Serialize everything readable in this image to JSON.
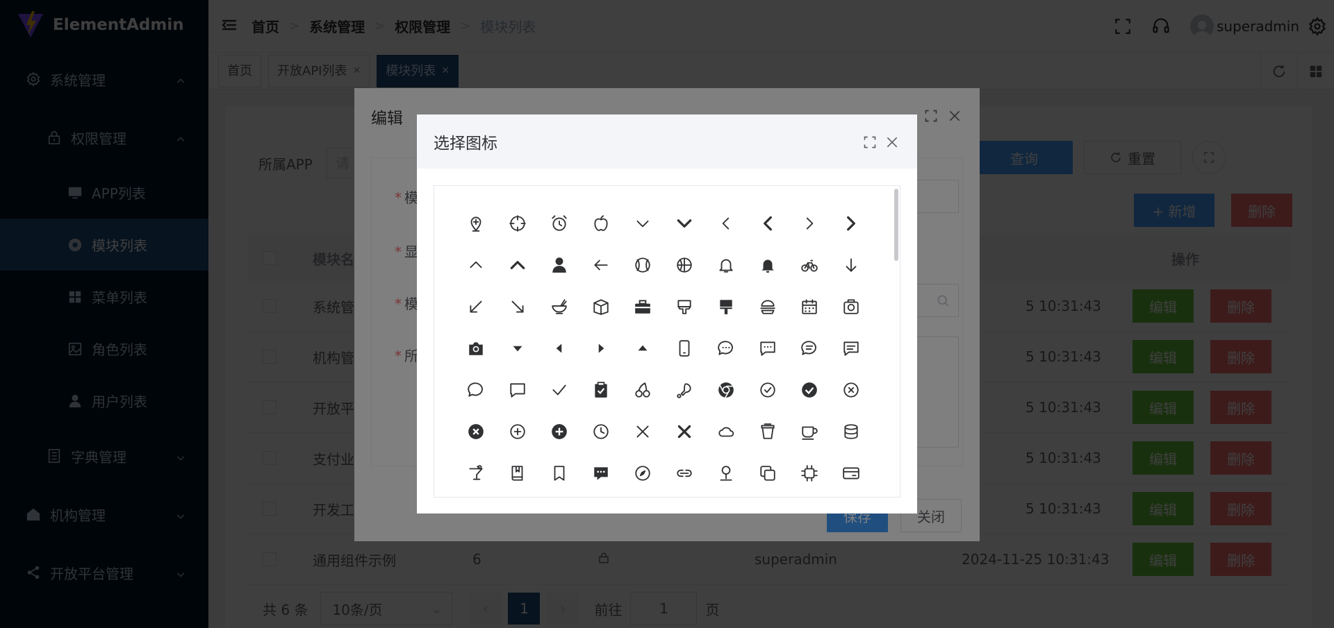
{
  "app": {
    "name": "ElementAdmin"
  },
  "sidebar": {
    "items": [
      {
        "label": "系统管理",
        "icon": "gear-icon",
        "level": 1,
        "expanded": true
      },
      {
        "label": "权限管理",
        "icon": "lock-icon",
        "level": 2,
        "expanded": true
      },
      {
        "label": "APP列表",
        "icon": "monitor-icon",
        "level": 3
      },
      {
        "label": "模块列表",
        "icon": "chrome-icon",
        "level": 3,
        "active": true
      },
      {
        "label": "菜单列表",
        "icon": "grid-icon",
        "level": 3
      },
      {
        "label": "角色列表",
        "icon": "picture-icon",
        "level": 3
      },
      {
        "label": "用户列表",
        "icon": "user-icon",
        "level": 3
      },
      {
        "label": "字典管理",
        "icon": "tickets-icon",
        "level": 2
      },
      {
        "label": "机构管理",
        "icon": "house-icon",
        "level": 1
      },
      {
        "label": "开放平台管理",
        "icon": "share-icon",
        "level": 1
      }
    ]
  },
  "header": {
    "breadcrumb": [
      "首页",
      "系统管理",
      "权限管理",
      "模块列表"
    ],
    "username": "superadmin"
  },
  "tags": [
    {
      "label": "首页",
      "closable": false,
      "active": false
    },
    {
      "label": "开放API列表",
      "closable": true,
      "active": false
    },
    {
      "label": "模块列表",
      "closable": true,
      "active": true
    }
  ],
  "search": {
    "app_label": "所属APP",
    "app_placeholder": "请",
    "query_label": "查询",
    "reset_label": "重置"
  },
  "toolbar": {
    "add_label": "+ 新增",
    "delete_label": "删除"
  },
  "table": {
    "headers": [
      "模块名",
      "操作"
    ],
    "rows": [
      {
        "name": "系统管",
        "time": "5 10:31:43"
      },
      {
        "name": "机构管",
        "time": "5 10:31:43"
      },
      {
        "name": "开放平",
        "time": "5 10:31:43"
      },
      {
        "name": "支付业",
        "time": "5 10:31:43"
      },
      {
        "name": "开发工",
        "time": "5 10:31:43"
      },
      {
        "name": "通用组件示例",
        "sort": "6",
        "creator": "superadmin",
        "time": "2024-11-25 10:31:43"
      }
    ],
    "edit_label": "编辑",
    "delete_label": "删除"
  },
  "pagination": {
    "total": "共 6 条",
    "page_size": "10条/页",
    "current": "1",
    "goto_label": "前往",
    "goto_value": "1",
    "page_suffix": "页"
  },
  "edit_dialog": {
    "title": "编辑",
    "fields": [
      "模",
      "显",
      "模",
      "所"
    ],
    "save_label": "保存",
    "close_label": "关闭"
  },
  "icon_dialog": {
    "title": "选择图标",
    "icons": [
      "add-location",
      "aim",
      "alarm-clock",
      "apple",
      "arrow-down",
      "arrow-down-bold",
      "arrow-left",
      "arrow-left-bold",
      "arrow-right",
      "arrow-right-bold",
      "arrow-up",
      "arrow-up-bold",
      "avatar",
      "back",
      "baseball",
      "basketball",
      "bell",
      "bell-filled",
      "bicycle",
      "bottom",
      "bottom-left",
      "bottom-right",
      "bowl",
      "box",
      "briefcase",
      "brush",
      "brush-filled",
      "burger",
      "calendar",
      "camera",
      "camera-filled",
      "caret-bottom",
      "caret-left",
      "caret-right",
      "caret-top",
      "cellphone",
      "chat-dot-round",
      "chat-dot-square",
      "chat-line-round",
      "chat-line-square",
      "chat-round",
      "chat-square",
      "check",
      "checked",
      "cherry",
      "chicken",
      "chrome-filled",
      "circle-check",
      "circle-check-filled",
      "circle-close",
      "circle-close-filled",
      "circle-plus",
      "circle-plus-filled",
      "clock",
      "close",
      "close-bold",
      "cloudy",
      "coffee",
      "coffee-cup",
      "coin",
      "cold-drink",
      "collection",
      "collection-tag",
      "comment",
      "compass",
      "connection",
      "coordinate",
      "copy-document",
      "cpu",
      "credit-card"
    ]
  }
}
